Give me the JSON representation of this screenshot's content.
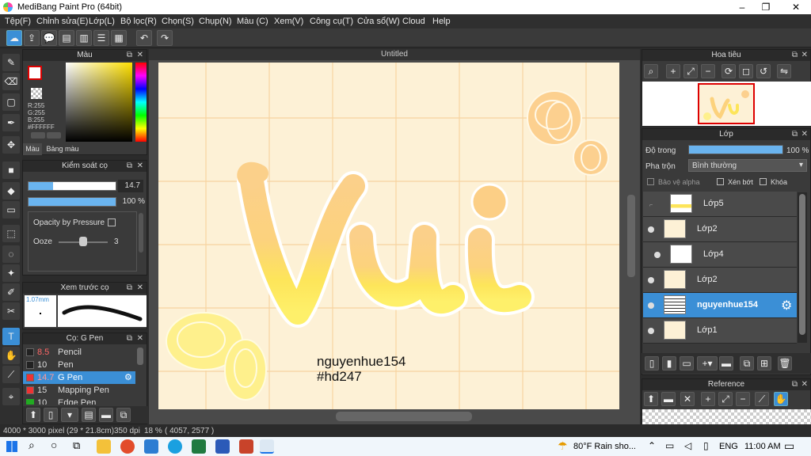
{
  "window": {
    "title": "MediBang Paint Pro (64bit)"
  },
  "menu": [
    "Tệp(F)",
    "Chỉnh sửa(E)",
    "Lớp(L)",
    "Bộ lọc(R)",
    "Chọn(S)",
    "Chụp(N)",
    "Màu (C)",
    "Xem(V)",
    "Công cụ(T)",
    "Cửa sổ(W)",
    "Cloud",
    "Help"
  ],
  "color_panel": {
    "title": "Màu",
    "r": "R:255",
    "g": "G:255",
    "b": "B:255",
    "hex": "#FFFFFF",
    "tabs": [
      "Màu",
      "Bảng màu"
    ]
  },
  "brush_control": {
    "title": "Kiểm soát cọ",
    "size": "14.7",
    "opacity": "100 %",
    "opacity_by_pressure": "Opacity by Pressure",
    "ooze_label": "Ooze",
    "ooze_value": "3"
  },
  "brush_preview": {
    "title": "Xem trước cọ",
    "size": "1.07mm"
  },
  "brush_list": {
    "title": "Cọ: G Pen",
    "items": [
      {
        "size": "8.5",
        "name": "Pencil"
      },
      {
        "size": "10",
        "name": "Pen"
      },
      {
        "size": "14.7",
        "name": "G Pen"
      },
      {
        "size": "15",
        "name": "Mapping Pen"
      },
      {
        "size": "10",
        "name": "Edge Pen"
      }
    ]
  },
  "canvas": {
    "tab": "Untitled",
    "lettering": "Vui",
    "signature_line1": "nguyenhue154",
    "signature_line2": "#hd247"
  },
  "navigator": {
    "title": "Hoa tiêu"
  },
  "layers": {
    "title": "Lớp",
    "opacity_label": "Độ trong",
    "opacity_value": "100 %",
    "blend_label": "Pha trộn",
    "blend_value": "Bình thường",
    "alpha_protect": "Bảo vệ alpha",
    "clipping": "Xén bớt",
    "lock": "Khóa",
    "items": [
      {
        "name": "Lớp5"
      },
      {
        "name": "Lớp2"
      },
      {
        "name": "Lớp4"
      },
      {
        "name": "Lớp2"
      },
      {
        "name": "nguyenhue154"
      },
      {
        "name": "Lớp1"
      }
    ]
  },
  "reference": {
    "title": "Reference"
  },
  "status": {
    "size": "4000 * 3000 pixel",
    "cm": "(29 * 21.8cm)",
    "dpi": "350 dpi",
    "zoom": "18 %",
    "coords": "( 4057, 2577 )"
  },
  "taskbar": {
    "weather": "80°F  Rain sho...",
    "lang": "ENG",
    "time": "11:00 AM"
  }
}
